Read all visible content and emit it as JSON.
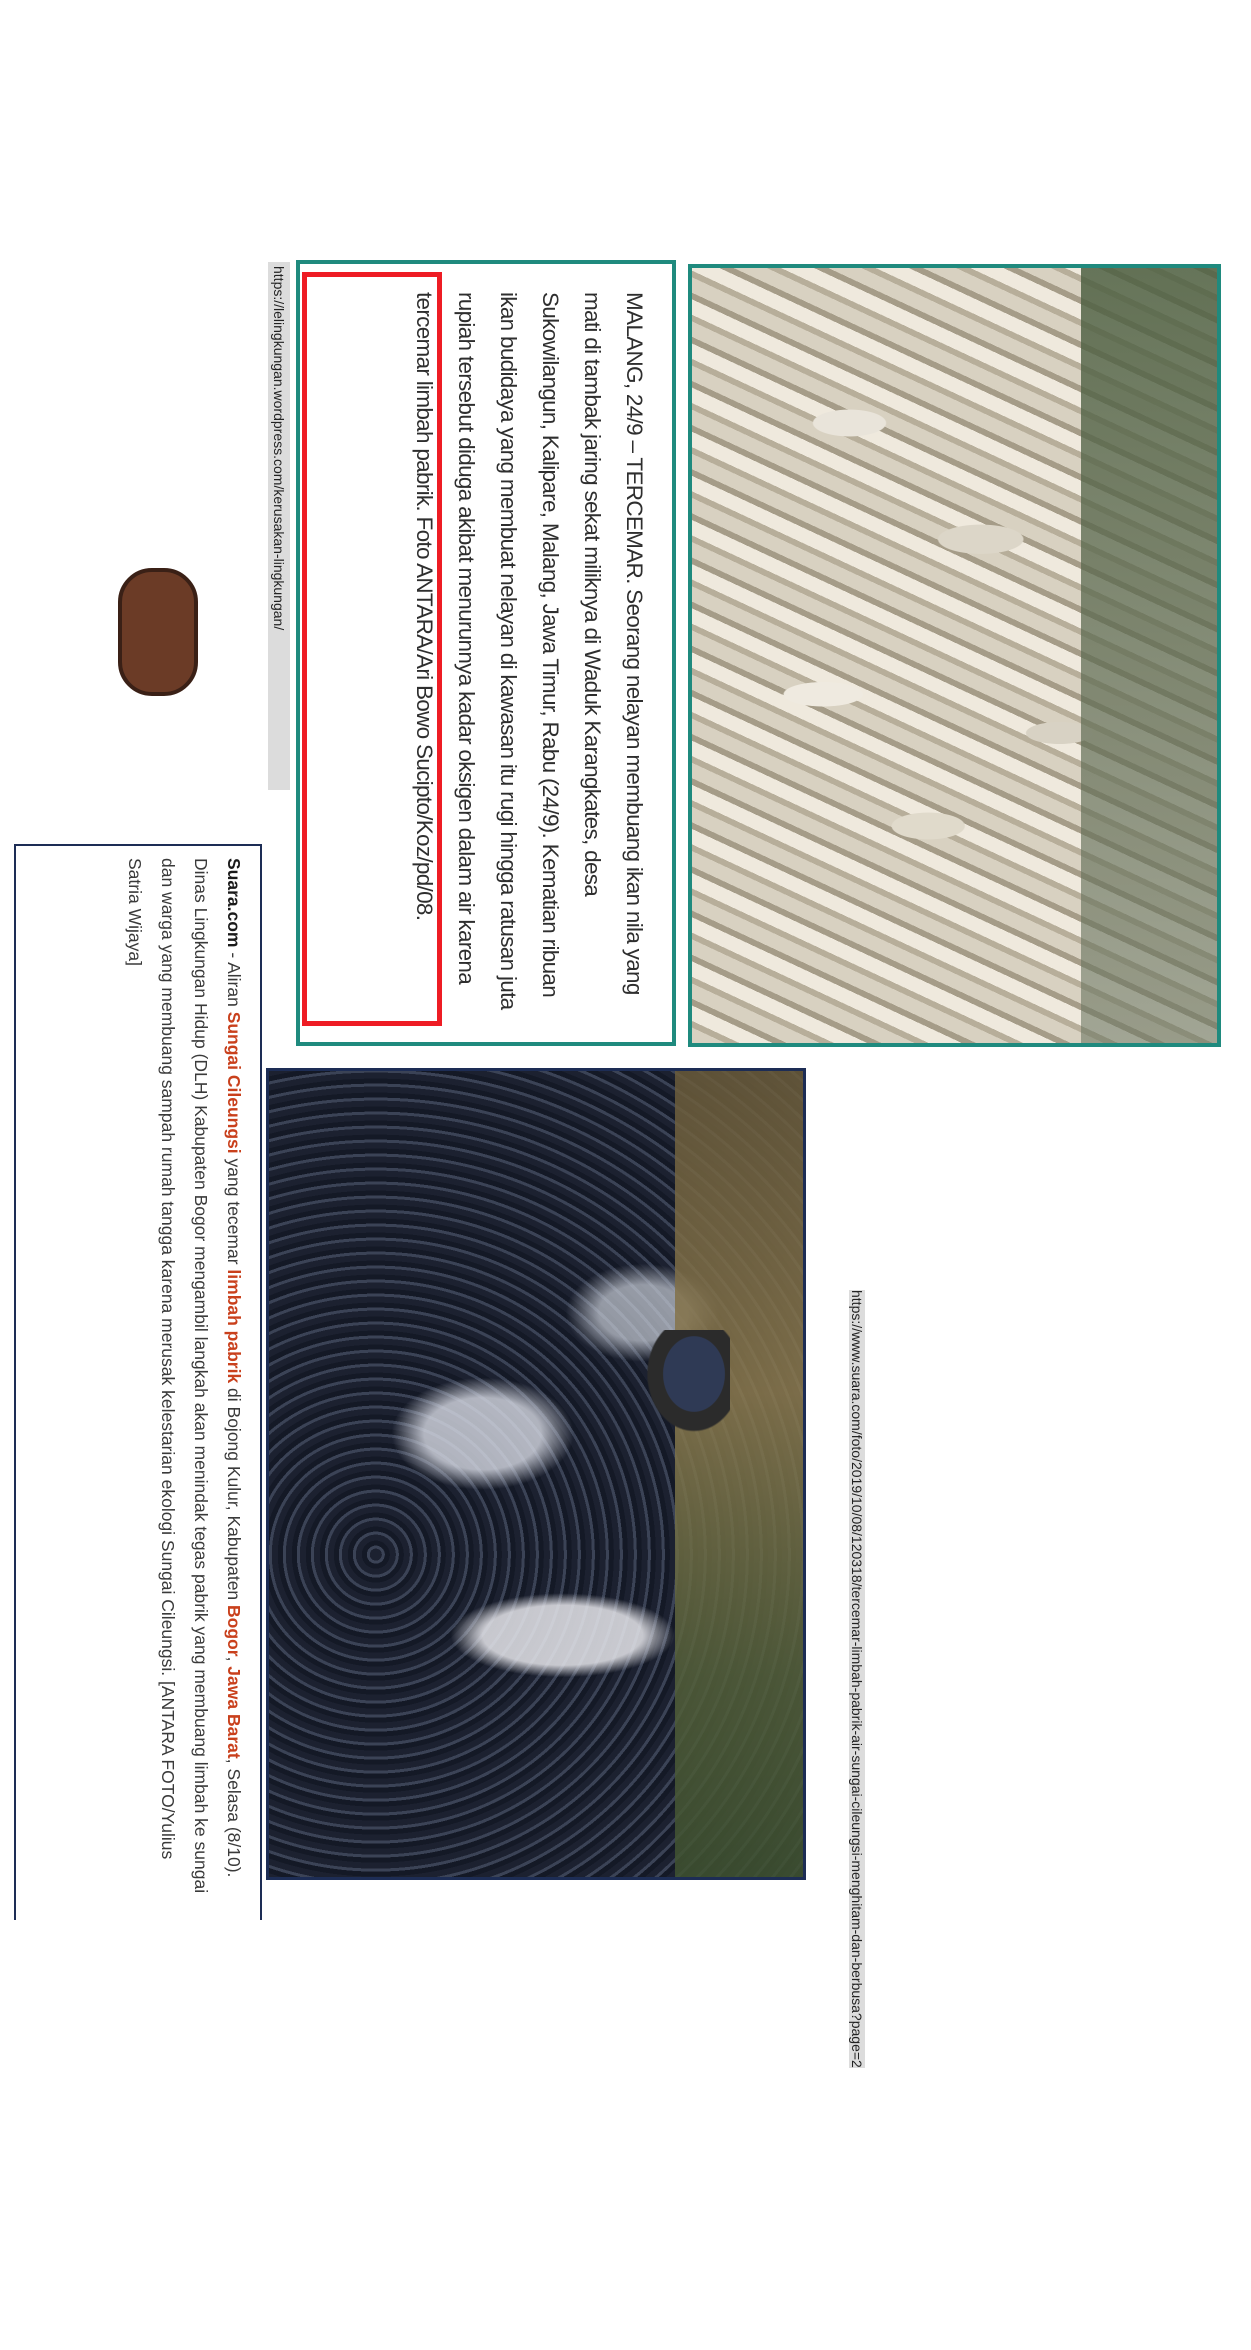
{
  "images": {
    "fish_photo": {
      "alt": "dead-fish-photo"
    },
    "river_photo": {
      "alt": "foamy-river-photo"
    }
  },
  "caption_1": {
    "text": "MALANG, 24/9 – TERCEMAR. Seorang nelayan membuang ikan nila yang mati di tambak jaring sekat miliknya di Waduk Karangkates, desa Sukowilangun, Kalipare, Malang, Jawa Timur, Rabu (24/9). Kematian ribuan ikan budidaya yang membuat nelayan di kawasan itu rugi hingga ratusan juta rupiah tersebut diduga akibat menurunnya kadar oksigen dalam air karena tercemar limbah pabrik. Foto ANTARA/Ari Bowo Sucipto/Koz/pd/08."
  },
  "url_1": "https://lelingkungan.wordpress.com/kerusakan-lingkungan/",
  "url_2": "https://www.suara.com/foto/2019/10/08/120318/tercemar-limbah-pabrik-air-sungai-cileungsi-menghitam-dan-berbusa?page=2",
  "caption_2": {
    "brand": "Suara.com",
    "dash": " - Aliran ",
    "river": "Sungai Cileungsi",
    "t1": " yang tecemar ",
    "waste": "limbah pabrik",
    "t2": " di Bojong Kulur, Kabupaten ",
    "bogor": "Bogor",
    "comma": ", ",
    "jabar": "Jawa Barat",
    "t3": ", Selasa (8/10). Dinas Lingkungan Hidup (DLH) Kabupaten Bogor mengambil langkah akan menindak tegas pabrik yang membuang limbah ke sungai dan warga yang membuang sampah rumah tangga karena merusak kelestarian ekologi Sungai Cileungsi. [ANTARA FOTO/Yulius Satria Wijaya]"
  },
  "colors": {
    "teal_border": "#1f8a7e",
    "navy_border": "#1d2d55",
    "highlight_red": "#ee1c24",
    "keyword_orange": "#c9401c"
  }
}
